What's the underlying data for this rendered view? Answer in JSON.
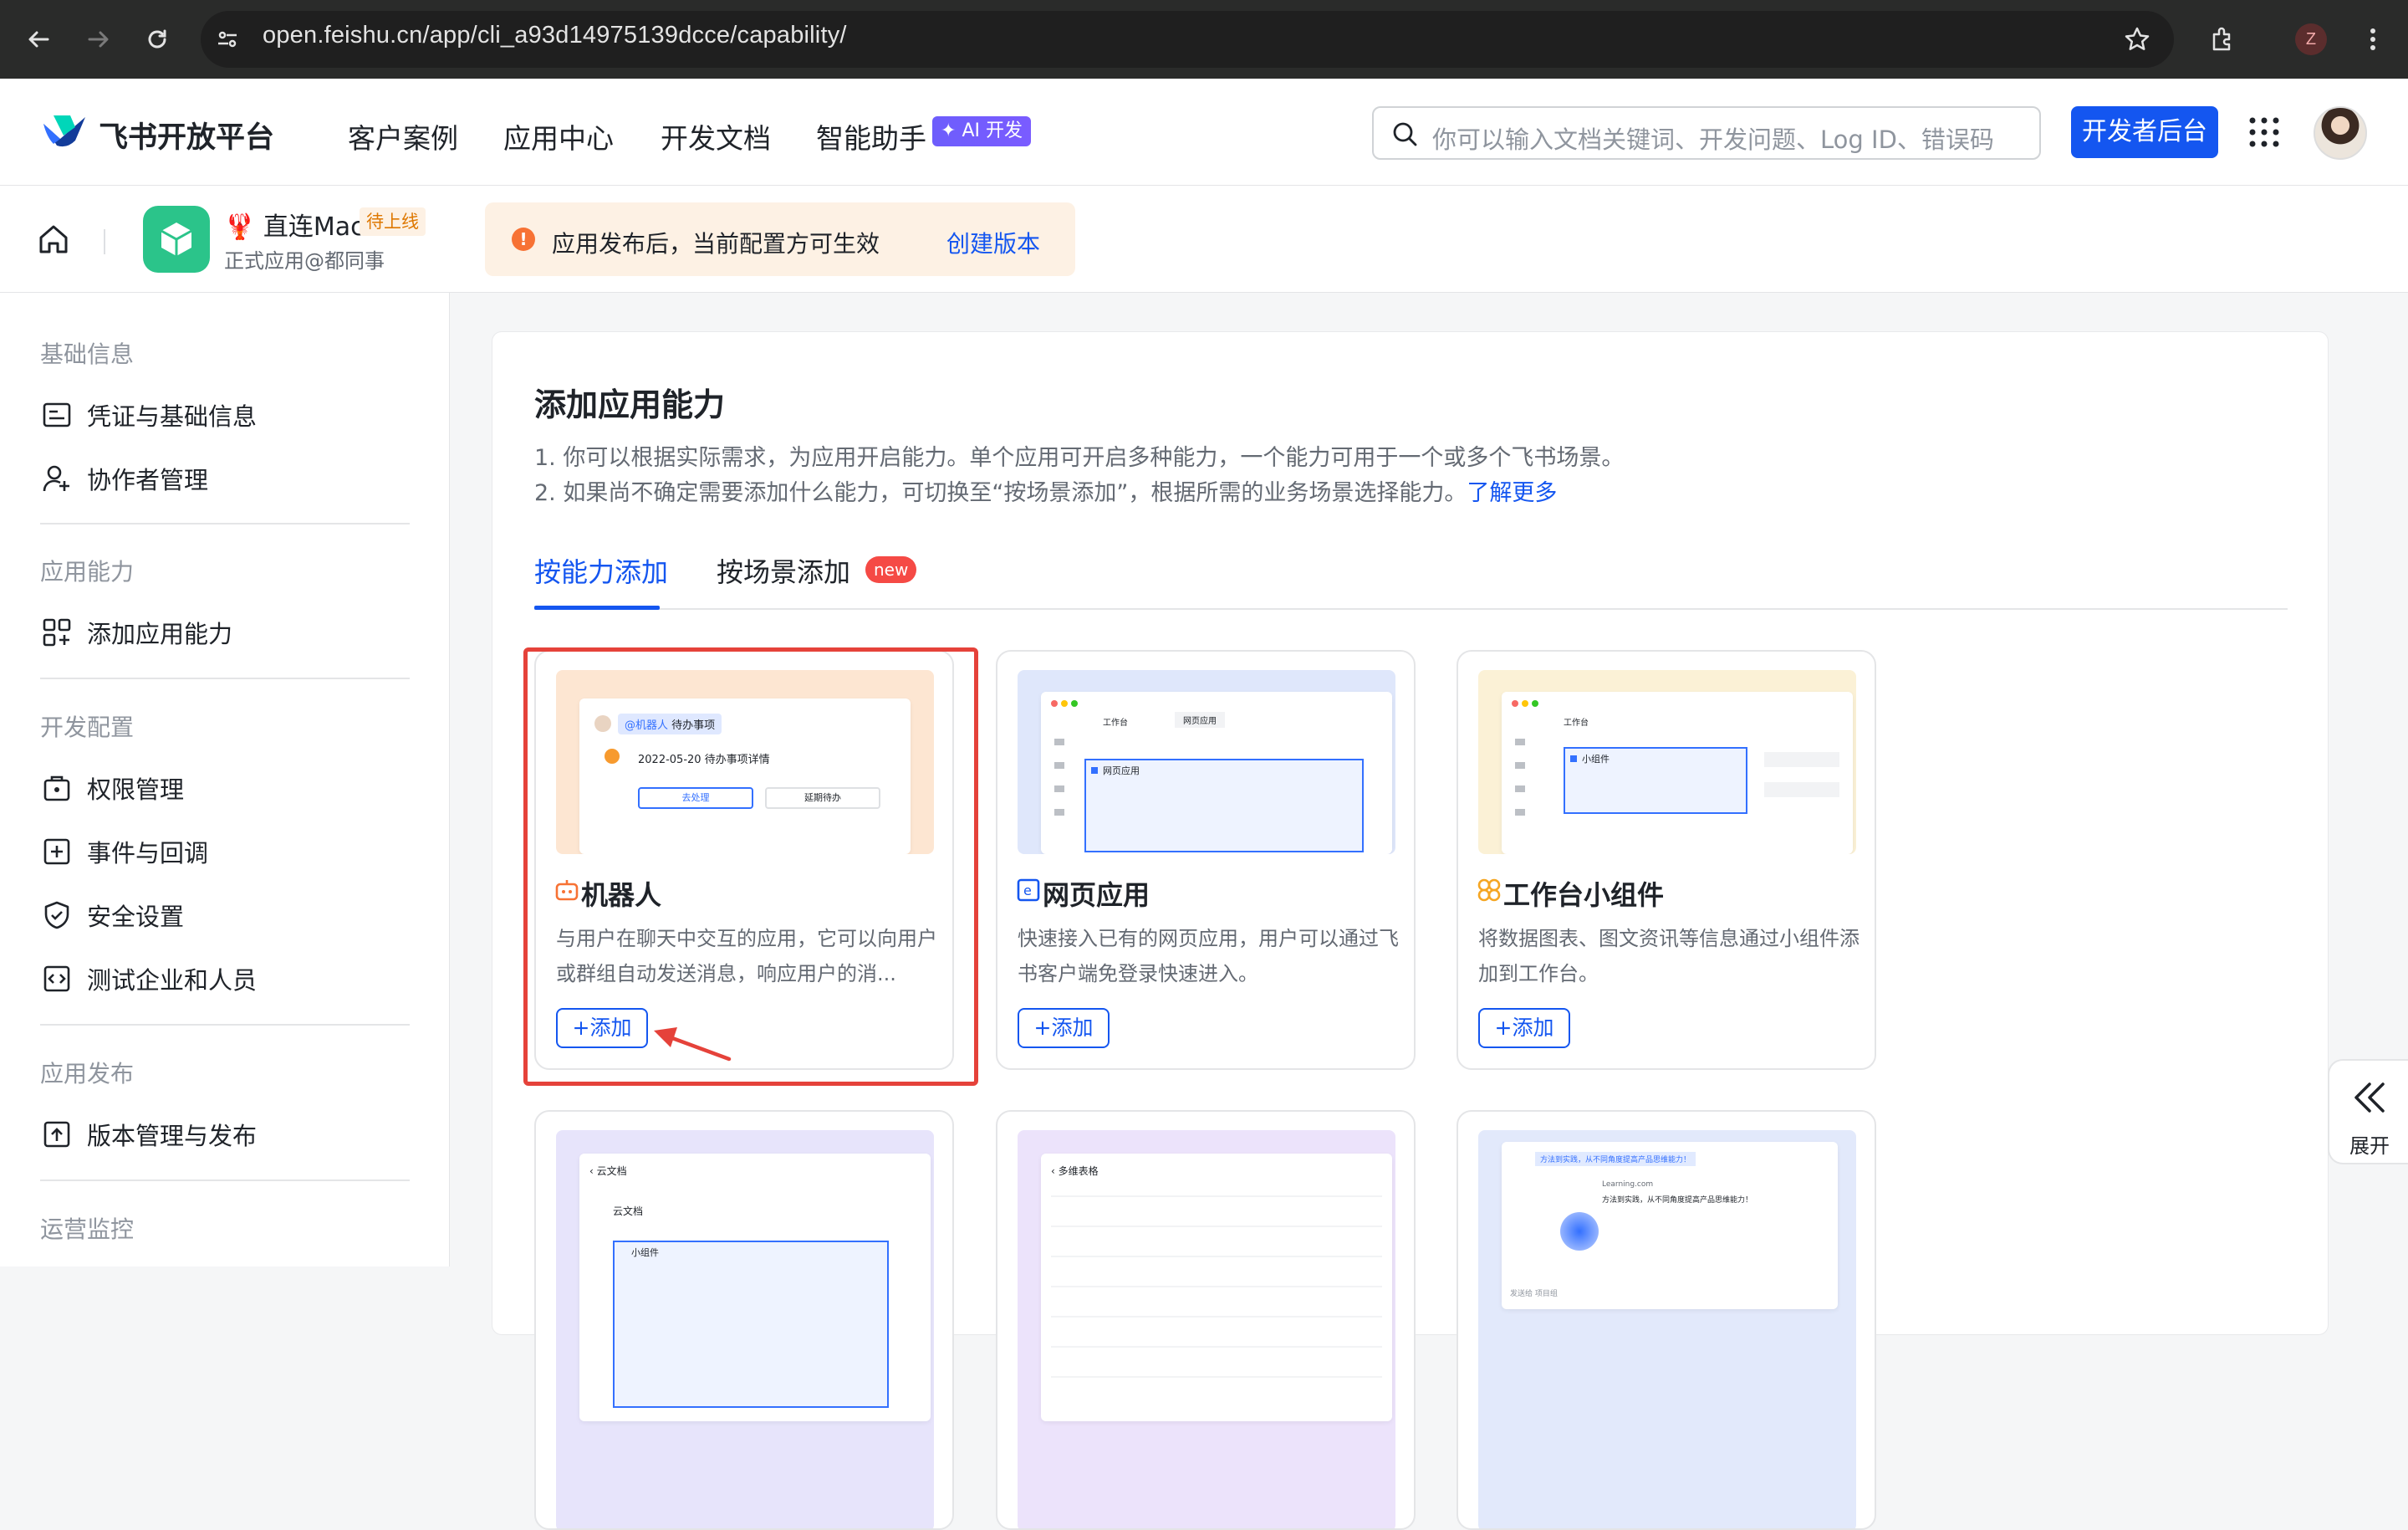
{
  "browser": {
    "url": "open.feishu.cn/app/cli_a93d14975139dcce/capability/",
    "profile_initial": "Z"
  },
  "topnav": {
    "brand": "飞书开放平台",
    "items": [
      "客户案例",
      "应用中心",
      "开发文档",
      "智能助手"
    ],
    "ai_badge": "AI 开发",
    "search_placeholder": "你可以输入文档关键词、开发问题、Log ID、错误码",
    "dev_console": "开发者后台"
  },
  "app": {
    "name": "直连Mac",
    "status": "待上线",
    "owner": "正式应用@都同事",
    "notice": "应用发布后，当前配置方可生效",
    "notice_link": "创建版本"
  },
  "sidebar": {
    "groups": [
      {
        "title": "基础信息",
        "items": [
          "凭证与基础信息",
          "协作者管理"
        ]
      },
      {
        "title": "应用能力",
        "items": [
          "添加应用能力"
        ]
      },
      {
        "title": "开发配置",
        "items": [
          "权限管理",
          "事件与回调",
          "安全设置",
          "测试企业和人员"
        ]
      },
      {
        "title": "应用发布",
        "items": [
          "版本管理与发布"
        ]
      },
      {
        "title": "运营监控",
        "items": []
      }
    ]
  },
  "main": {
    "title": "添加应用能力",
    "desc1": "1. 你可以根据实际需求，为应用开启能力。单个应用可开启多种能力，一个能力可用于一个或多个飞书场景。",
    "desc2": "2. 如果尚不确定需要添加什么能力，可切换至“按场景添加”，根据所需的业务场景选择能力。",
    "learn_more": "了解更多",
    "tabs": [
      "按能力添加",
      "按场景添加"
    ],
    "new_badge": "new",
    "cards": [
      {
        "title": "机器人",
        "desc": "与用户在聊天中交互的应用，它可以向用户或群组自动发送消息，响应用户的消...",
        "add": "添加",
        "thumb": {
          "tag": "@机器人",
          "tag2": "待办事项",
          "line": "2022-05-20 待办事项详情",
          "btn1": "去处理",
          "btn2": "延期待办"
        }
      },
      {
        "title": "网页应用",
        "desc": "快速接入已有的网页应用，用户可以通过飞书客户端免登录快速进入。",
        "add": "添加",
        "thumb": {
          "tab1": "工作台",
          "tab2": "网页应用",
          "label": "网页应用"
        }
      },
      {
        "title": "工作台小组件",
        "desc": "将数据图表、图文资讯等信息通过小组件添加到工作台。",
        "add": "添加",
        "thumb": {
          "tab1": "工作台",
          "label": "小组件"
        }
      }
    ],
    "bottom_cards": [
      {
        "head": "云文档",
        "sub": "云文档",
        "label": "小组件"
      },
      {
        "head": "多维表格"
      },
      {
        "line1": "方法到实践，从不同角度提高产品思维能力！",
        "site": "Learning.com",
        "line2": "方法到实践，从不同角度提高产品思维能力！",
        "input": "发送给 项目组"
      }
    ]
  },
  "expand": {
    "label": "展开"
  },
  "colors": {
    "accent": "#1456f0",
    "highlight": "#e5423a",
    "status": "#de7802"
  }
}
